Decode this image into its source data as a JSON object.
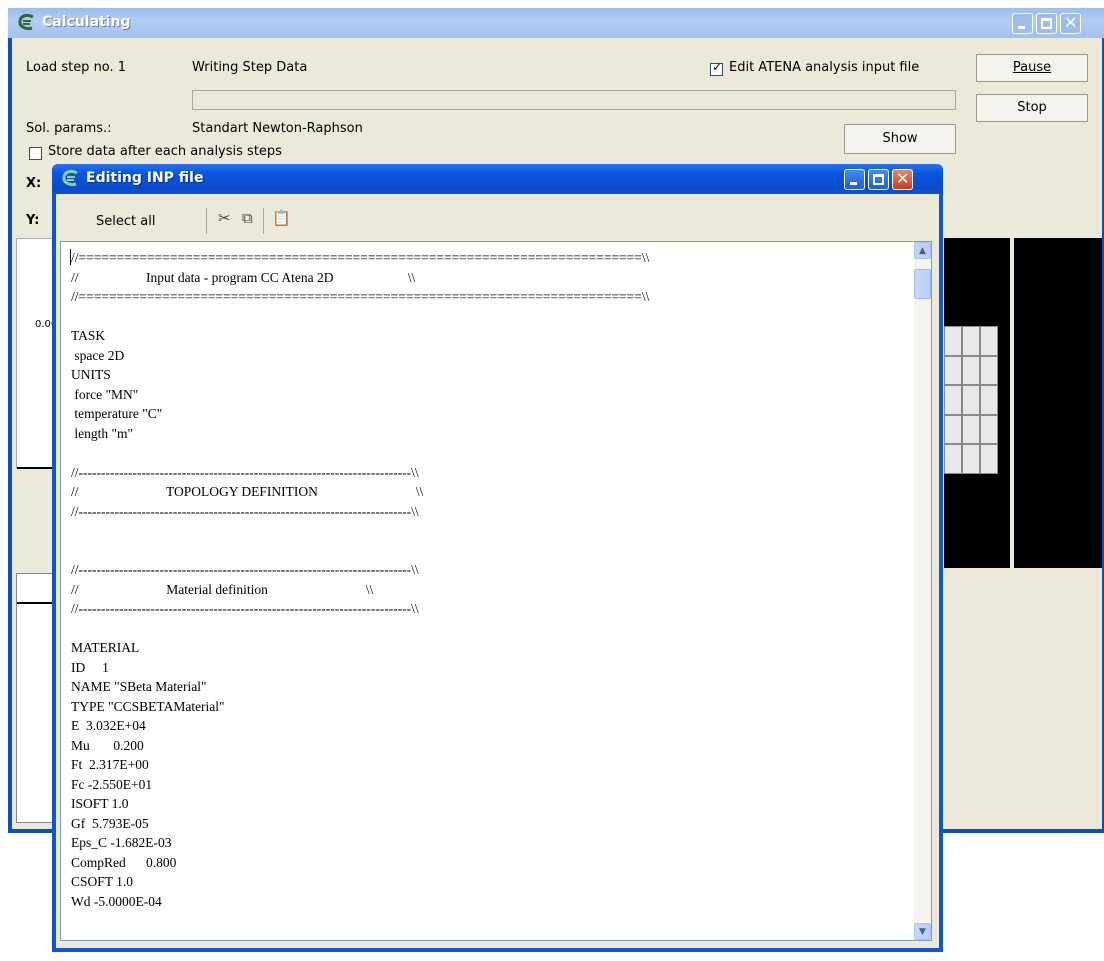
{
  "main_window": {
    "title": "Calculating",
    "load_step_label": "Load step no. 1",
    "status_text": "Writing Step Data",
    "edit_input_checkbox": {
      "label": "Edit ATENA analysis  input file",
      "checked": true
    },
    "pause_button": "Pause",
    "stop_button": "Stop",
    "sol_params_label": "Sol. params.:",
    "sol_params_value": "Standart Newton-Raphson",
    "show_button": "Show",
    "store_data_checkbox": {
      "label": "Store data after each analysis steps",
      "checked": false
    },
    "x_label": "X:",
    "y_label": "Y:",
    "axis_value": "0.00",
    "progress": 0
  },
  "edit_window": {
    "title": "Editing INP file",
    "select_all_button": "Select all",
    "toolbar_icons": [
      "cut-icon",
      "copy-icon",
      "paste-icon"
    ],
    "content_lines": [
      "//==========================================================================\\\\",
      "//                    Input data - program CC Atena 2D                      \\\\",
      "//==========================================================================\\\\",
      "",
      "TASK",
      " space 2D",
      "UNITS",
      " force \"MN\"",
      " temperature \"C\"",
      " length \"m\"",
      "",
      "//--------------------------------------------------------------------------\\\\",
      "//                          TOPOLOGY DEFINITION                             \\\\",
      "//--------------------------------------------------------------------------\\\\",
      "",
      "",
      "//--------------------------------------------------------------------------\\\\",
      "//                          Material definition                             \\\\",
      "//--------------------------------------------------------------------------\\\\",
      "",
      "MATERIAL",
      "ID     1",
      "NAME \"SBeta Material\"",
      "TYPE \"CCSBETAMaterial\"",
      "E  3.032E+04",
      "Mu       0.200",
      "Ft  2.317E+00",
      "Fc -2.550E+01",
      "ISOFT 1.0",
      "Gf  5.793E-05",
      "Eps_C -1.682E-03",
      "CompRed      0.800",
      "CSOFT 1.0",
      "Wd -5.0000E-04"
    ]
  },
  "colors": {
    "xp_title_active": "#0a57e0",
    "xp_title_inactive": "#9cbdf0",
    "dialog_face": "#ece9d8",
    "close_red": "#c73d1f"
  }
}
